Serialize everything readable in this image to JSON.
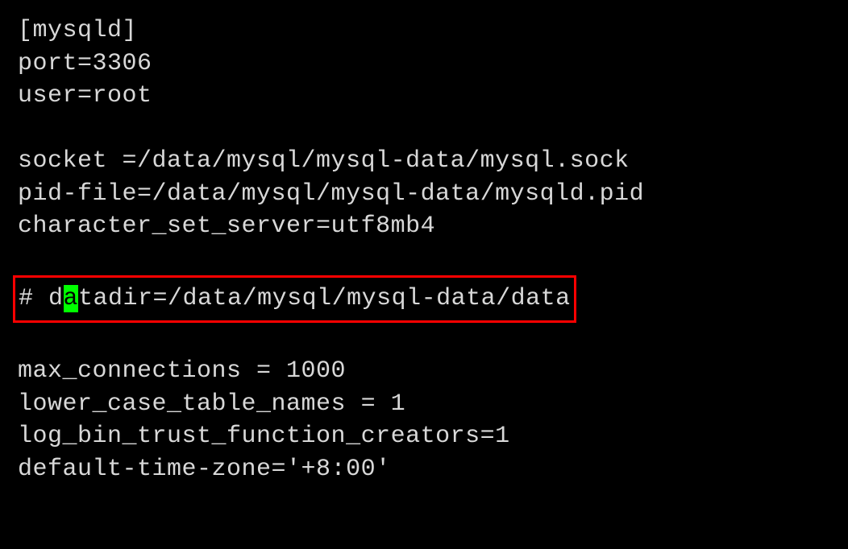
{
  "config": {
    "lines": {
      "l1": "[mysqld]",
      "l2": "port=3306",
      "l3": "user=root",
      "l4": "socket =/data/mysql/mysql-data/mysql.sock",
      "l5": "pid-file=/data/mysql/mysql-data/mysqld.pid",
      "l6": "character_set_server=utf8mb4",
      "l7_prefix": "# d",
      "l7_cursor": "a",
      "l7_suffix": "tadir=/data/mysql/mysql-data/data",
      "l8": "max_connections = 1000",
      "l9": "lower_case_table_names = 1",
      "l10": "log_bin_trust_function_creators=1",
      "l11": "default-time-zone='+8:00'"
    }
  }
}
